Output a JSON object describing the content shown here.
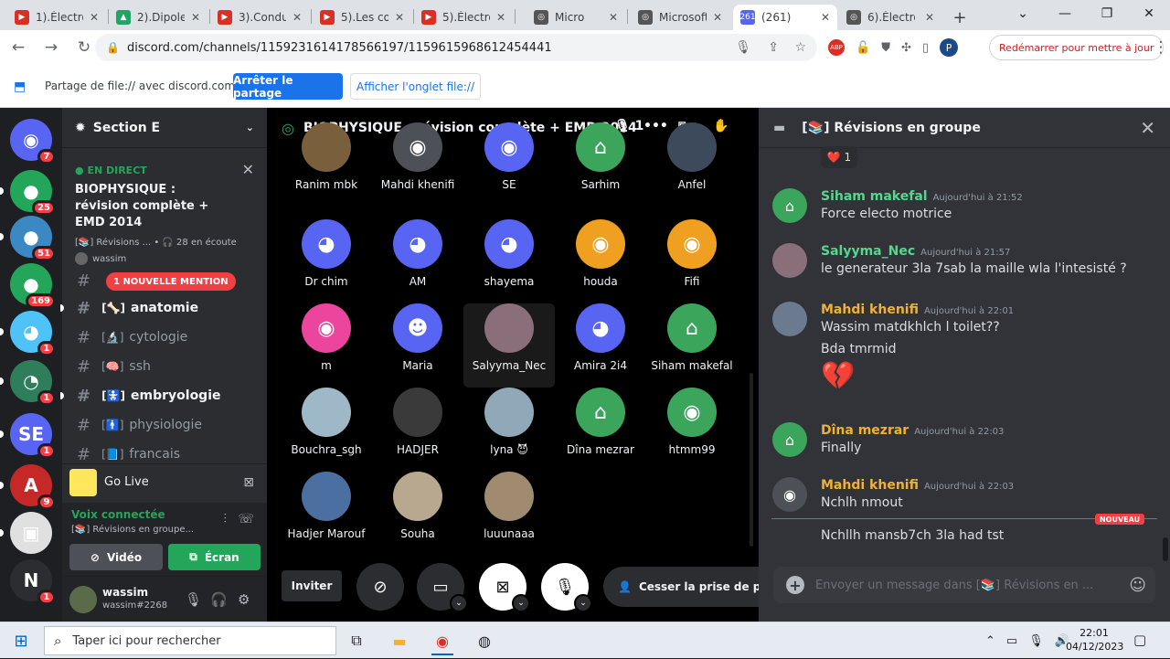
{
  "browser": {
    "tabs": [
      {
        "label": "1).Électro",
        "color": "#d93025",
        "glyph": "▶"
      },
      {
        "label": "2).Dipole",
        "color": "#1fa463",
        "glyph": "▲"
      },
      {
        "label": "3).Conduc",
        "color": "#d93025",
        "glyph": "▶"
      },
      {
        "label": "5).Les con",
        "color": "#d93025",
        "glyph": "▶"
      },
      {
        "label": "5).Électro",
        "color": "#d93025",
        "glyph": "▶"
      },
      {
        "label": "Micro",
        "color": "#555555",
        "glyph": "◎"
      },
      {
        "label": "Microsoft",
        "color": "#555555",
        "glyph": "◎"
      },
      {
        "label": "(261)",
        "color": "#5865f2",
        "glyph": "261"
      },
      {
        "label": "6).Électro",
        "color": "#555555",
        "glyph": "◎"
      }
    ],
    "new_tab": "+",
    "url": "discord.com/channels/1159231614178566197/1159615968612454441",
    "restart": "Redémarrer pour mettre à jour",
    "profile": "P",
    "share_message": "Partage de file:// avec discord.com...",
    "stop_share": "Arrêter le partage",
    "show_tab": "Afficher l'onglet file://"
  },
  "servers": [
    {
      "label": "",
      "badge": "7",
      "color": "#5865f2",
      "glyph": "◉"
    },
    {
      "label": "",
      "badge": "25",
      "color": "#23a55a",
      "glyph": "●"
    },
    {
      "label": "",
      "badge": "51",
      "color": "#3b88c3",
      "glyph": "●"
    },
    {
      "label": "",
      "badge": "169",
      "color": "#23a55a",
      "glyph": "●"
    },
    {
      "label": "",
      "badge": "1",
      "color": "#4fc3f7",
      "glyph": "◕"
    },
    {
      "label": "",
      "badge": "1",
      "color": "#2e7d5b",
      "glyph": "◔"
    },
    {
      "label": "SE",
      "badge": "1",
      "color": "#5865f2",
      "glyph": ""
    },
    {
      "label": "",
      "badge": "9",
      "color": "#c62828",
      "glyph": "A"
    },
    {
      "label": "",
      "badge": "",
      "color": "#e0e0e0",
      "glyph": "▣"
    },
    {
      "label": "N",
      "badge": "1",
      "color": "#2b2d31",
      "glyph": ""
    }
  ],
  "guild": {
    "name": "Section E",
    "event": {
      "live": "EN DIRECT",
      "title": "BIOPHYSIQUE : révision complète + EMD 2014",
      "meta": "[📚] Révisions ...  • 🎧 28 en écoute",
      "user": "wassim"
    },
    "mention": "1 NOUVELLE MENTION",
    "channels": [
      {
        "name": "anatomie",
        "emoji": "[🦴]",
        "unread": true
      },
      {
        "name": "cytologie",
        "emoji": "[🔬]",
        "unread": false
      },
      {
        "name": "ssh",
        "emoji": "[🧠]",
        "unread": false
      },
      {
        "name": "embryologie",
        "emoji": "[🚼]",
        "unread": true
      },
      {
        "name": "physiologie",
        "emoji": "[🚹]",
        "unread": false
      },
      {
        "name": "francais",
        "emoji": "[📘]",
        "unread": false
      }
    ],
    "go_live": "Go Live",
    "voice_connected": "Voix connectée",
    "voice_sub": "[📚] Révisions en groupe...",
    "video_btn": "Vidéo",
    "screen_btn": "Écran",
    "user": {
      "name": "wassim",
      "tag": "wassim#2268"
    }
  },
  "stage": {
    "title": "BIOPHYSIQUE : révision complète + EMD 2014",
    "speaker_count": "1",
    "participants": [
      {
        "name": "Ranim mbk",
        "color": "#7a5f3c",
        "glyph": ""
      },
      {
        "name": "Mahdi khenifi",
        "color": "#4e5058",
        "glyph": "◉"
      },
      {
        "name": "SE",
        "color": "#5865f2",
        "glyph": "◉"
      },
      {
        "name": "Sarhim",
        "color": "#3ba55c",
        "glyph": "⌂"
      },
      {
        "name": "Anfel",
        "color": "#3d4a5c",
        "glyph": ""
      },
      {
        "name": "Dr chim",
        "color": "#5865f2",
        "glyph": "◕"
      },
      {
        "name": "AM",
        "color": "#5865f2",
        "glyph": "◕"
      },
      {
        "name": "shayema",
        "color": "#5865f2",
        "glyph": "◕"
      },
      {
        "name": "houda",
        "color": "#f0a020",
        "glyph": "◉"
      },
      {
        "name": "Fifi",
        "color": "#f0a020",
        "glyph": "◉"
      },
      {
        "name": "m",
        "color": "#eb459e",
        "glyph": "◉"
      },
      {
        "name": "Maria",
        "color": "#5865f2",
        "glyph": "☻"
      },
      {
        "name": "Salyyma_Nec",
        "color": "#8a6f7a",
        "glyph": ""
      },
      {
        "name": "Amira 2i4",
        "color": "#5865f2",
        "glyph": "◕"
      },
      {
        "name": "Siham makefal",
        "color": "#3ba55c",
        "glyph": "⌂"
      },
      {
        "name": "Bouchra_sgh",
        "color": "#9fb8c8",
        "glyph": ""
      },
      {
        "name": "HADJER",
        "color": "#3a3a3a",
        "glyph": ""
      },
      {
        "name": "lyna 😈",
        "color": "#8fa9b8",
        "glyph": ""
      },
      {
        "name": "Dîna mezrar",
        "color": "#3ba55c",
        "glyph": "⌂"
      },
      {
        "name": "htmm99",
        "color": "#3ba55c",
        "glyph": "◉"
      },
      {
        "name": "Hadjer Marouf",
        "color": "#4a6fa0",
        "glyph": ""
      },
      {
        "name": "Souha",
        "color": "#b8a890",
        "glyph": ""
      },
      {
        "name": "luuunaaa",
        "color": "#a08a70",
        "glyph": ""
      }
    ],
    "invite": "Inviter",
    "stop_speaking": "Cesser la prise de parole"
  },
  "thread": {
    "title": "[📚] Révisions en groupe",
    "reaction": "❤️ 1",
    "messages": [
      {
        "user": "Siham makefal",
        "time": "Aujourd'hui à 21:52",
        "color": "#57d68d",
        "lines": [
          "Force electo motrice"
        ],
        "avcolor": "#3ba55c",
        "glyph": "⌂"
      },
      {
        "user": "Salyyma_Nec",
        "time": "Aujourd'hui à 21:57",
        "color": "#57d68d",
        "lines": [
          "le generateur 3la 7sab la maille wla l'intesisté ?"
        ],
        "avcolor": "#8a6f7a",
        "glyph": ""
      },
      {
        "user": "Mahdi khenifi",
        "time": "Aujourd'hui à 22:01",
        "color": "#f0b232",
        "lines": [
          "Wassim matdkhlch l toilet??",
          "Bda tmrmid",
          "💔"
        ],
        "avcolor": "#6b7a8f",
        "glyph": ""
      },
      {
        "user": "Dîna mezrar",
        "time": "Aujourd'hui à 22:03",
        "color": "#f0b232",
        "lines": [
          "Finally"
        ],
        "avcolor": "#3ba55c",
        "glyph": "⌂"
      },
      {
        "user": "Mahdi khenifi",
        "time": "Aujourd'hui à 22:03",
        "color": "#f0b232",
        "lines": [
          "Nchlh nmout"
        ],
        "avcolor": "#4e5058",
        "glyph": "◉"
      }
    ],
    "new_label": "NOUVEAU",
    "last_line": "Nchllh mansb7ch 3la had tst",
    "placeholder": "Envoyer un message dans  [📚]  Révisions en ..."
  },
  "taskbar": {
    "search": "Taper ici pour rechercher",
    "time": "22:01",
    "date": "04/12/2023"
  }
}
